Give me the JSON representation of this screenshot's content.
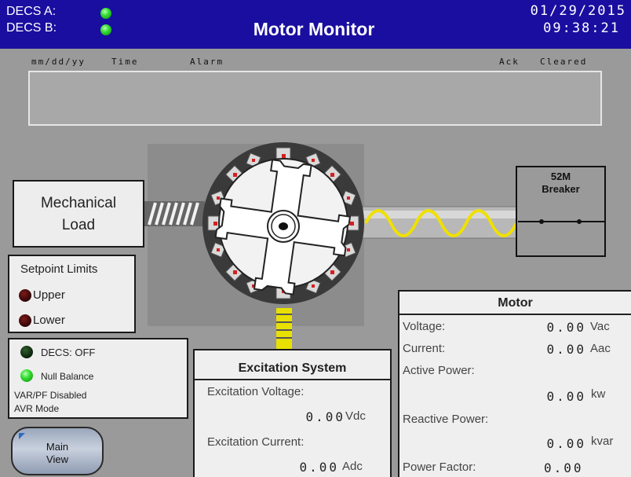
{
  "header": {
    "decs_a_label": "DECS A:",
    "decs_b_label": "DECS B:",
    "title": "Motor Monitor",
    "date": "01/29/2015",
    "time": "09:38:21",
    "colors": {
      "background": "#1a0ea0",
      "indicator_on": "#33dd33"
    }
  },
  "alarm_table": {
    "columns": {
      "date": "mm/dd/yy",
      "time": "Time",
      "alarm": "Alarm",
      "ack": "Ack",
      "cleared": "Cleared"
    },
    "rows": []
  },
  "mechanical_load": {
    "line1": "Mechanical",
    "line2": "Load"
  },
  "breaker": {
    "line1": "52M",
    "line2": "Breaker"
  },
  "setpoint_limits": {
    "title": "Setpoint Limits",
    "upper": "Upper",
    "lower": "Lower"
  },
  "status": {
    "decs": "DECS: OFF",
    "null_balance": "Null Balance",
    "var_pf": "VAR/PF Disabled",
    "mode": "AVR Mode"
  },
  "main_view_button": {
    "line1": "Main",
    "line2": "View"
  },
  "excitation": {
    "title": "Excitation System",
    "voltage_label": "Excitation Voltage:",
    "voltage_value": "0.00",
    "voltage_unit": "Vdc",
    "current_label": "Excitation Current:",
    "current_value": "0.00",
    "current_unit": "Adc"
  },
  "motor": {
    "title": "Motor",
    "voltage_label": "Voltage:",
    "voltage_value": "0.00",
    "voltage_unit": "Vac",
    "current_label": "Current:",
    "current_value": "0.00",
    "current_unit": "Aac",
    "active_power_label": "Active Power:",
    "active_power_value": "0.00",
    "active_power_unit": "kw",
    "reactive_power_label": "Reactive Power:",
    "reactive_power_value": "0.00",
    "reactive_power_unit": "kvar",
    "power_factor_label": "Power Factor:",
    "power_factor_value": "0.00"
  }
}
